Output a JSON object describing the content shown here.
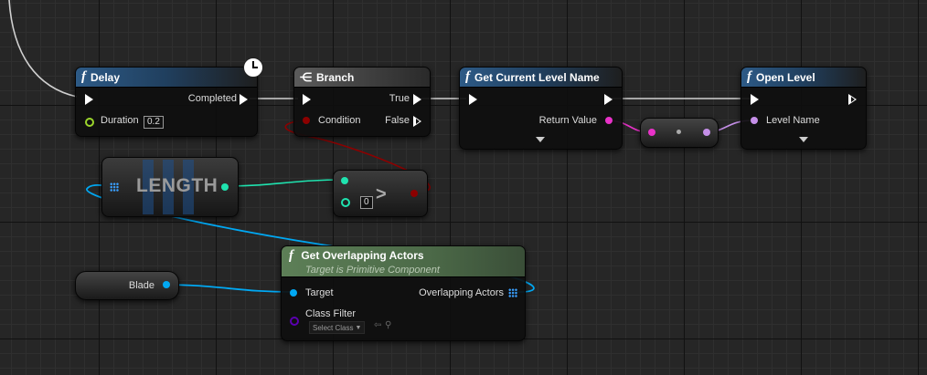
{
  "delay": {
    "title": "Delay",
    "completed": "Completed",
    "duration_label": "Duration",
    "duration_value": "0.2",
    "icon": "f"
  },
  "branch": {
    "title": "Branch",
    "true_label": "True",
    "false_label": "False",
    "condition_label": "Condition"
  },
  "get_level": {
    "title": "Get Current Level Name",
    "return_label": "Return Value",
    "icon": "f"
  },
  "open_level": {
    "title": "Open Level",
    "level_name_label": "Level Name",
    "icon": "f"
  },
  "length": {
    "title": "LENGTH"
  },
  "compare": {
    "operator": ">",
    "value": "0"
  },
  "overlap": {
    "title": "Get Overlapping Actors",
    "subtitle": "Target is Primitive Component",
    "target_label": "Target",
    "output_label": "Overlapping Actors",
    "class_filter_label": "Class Filter",
    "select_class": "Select Class",
    "icon": "f"
  },
  "blade": {
    "label": "Blade"
  },
  "colors": {
    "exec": "#ffffff",
    "float": "#9cd62c",
    "bool": "#8c0000",
    "string": "#e832c8",
    "name": "#c58fe8",
    "object": "#00a8f3",
    "int": "#1fe3af",
    "class": "#5b00b0"
  }
}
